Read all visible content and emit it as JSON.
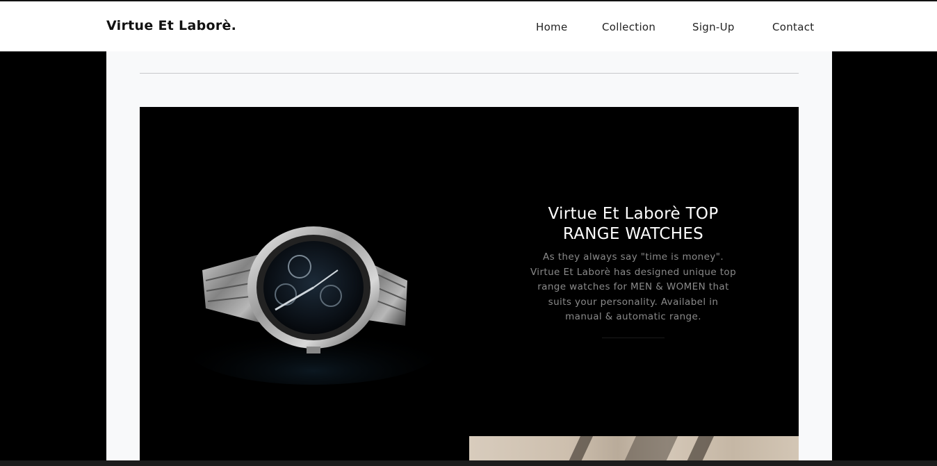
{
  "brand": "Virtue Et Laborè.",
  "nav": {
    "home": "Home",
    "collection": "Collection",
    "signup": "Sign-Up",
    "contact": "Contact"
  },
  "hero": {
    "title_line1": "Virtue Et Laborè TOP",
    "title_line2": "RANGE WATCHES",
    "desc_lines": [
      "As they always say \"time is money\".",
      "Virtue Et Laborè has designed unique top",
      "range watches for MEN & WOMEN that",
      "suits your personality. Availabel in",
      "manual & automatic range."
    ]
  },
  "colors": {
    "navbar_bg": "#ffffff",
    "page_bg": "#000000",
    "container_bg": "#f8f9fa",
    "hero_bg": "#000000",
    "hero_title": "#ffffff",
    "hero_desc": "#8a8a8a"
  }
}
